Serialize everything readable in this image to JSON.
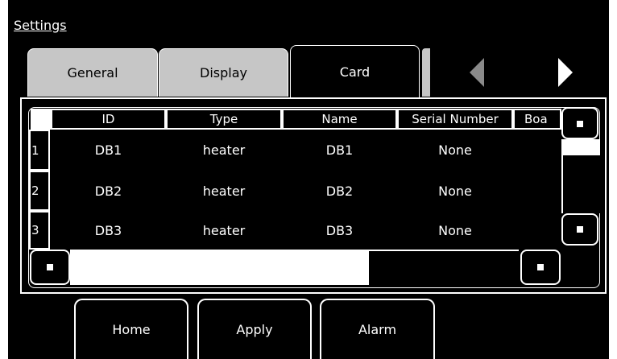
{
  "title": "Settings",
  "tabs": [
    {
      "label": "General",
      "active": false
    },
    {
      "label": "Display",
      "active": false
    },
    {
      "label": "Card",
      "active": true
    }
  ],
  "icons": {
    "tab_prev": "triangle-left-icon",
    "tab_next": "triangle-right-icon"
  },
  "table": {
    "columns": [
      "ID",
      "Type",
      "Name",
      "Serial Number",
      "Boa"
    ],
    "rows": [
      {
        "num": "1",
        "id": "DB1",
        "type": "heater",
        "name": "DB1",
        "serial": "None"
      },
      {
        "num": "2",
        "id": "DB2",
        "type": "heater",
        "name": "DB2",
        "serial": "None"
      },
      {
        "num": "3",
        "id": "DB3",
        "type": "heater",
        "name": "DB3",
        "serial": "None"
      }
    ]
  },
  "buttons": {
    "home": "Home",
    "apply": "Apply",
    "alarm": "Alarm"
  },
  "colors": {
    "background": "#000000",
    "foreground": "#ffffff",
    "inactive_tab": "#c6c6c6",
    "disabled_arrow": "#8a8a8a"
  }
}
